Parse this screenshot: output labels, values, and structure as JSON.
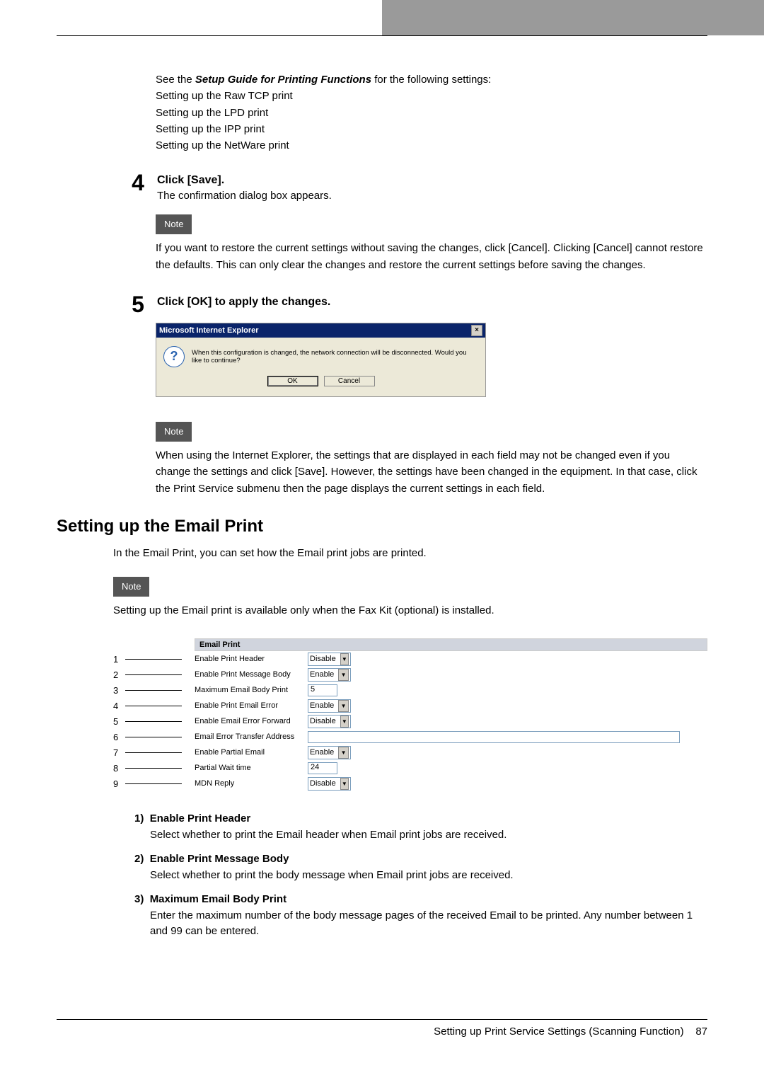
{
  "intro": {
    "prefix": "See the ",
    "guide_title": "Setup Guide for Printing Functions",
    "suffix": " for the following settings:",
    "lines": [
      "Setting up the Raw TCP print",
      "Setting up the LPD print",
      "Setting up the IPP print",
      "Setting up the NetWare print"
    ]
  },
  "step4": {
    "number": "4",
    "title": "Click [Save].",
    "desc": "The confirmation dialog box appears."
  },
  "note1": {
    "label": "Note",
    "text": "If you want to restore the current settings without saving the changes, click [Cancel]. Clicking [Cancel] cannot restore the defaults. This can only clear the changes and restore the current settings before saving the changes."
  },
  "step5": {
    "number": "5",
    "title": "Click [OK] to apply the changes."
  },
  "dialog": {
    "title": "Microsoft Internet Explorer",
    "message": "When this configuration is changed, the network connection will be disconnected.  Would you like to continue?",
    "ok": "OK",
    "cancel": "Cancel",
    "close": "×",
    "icon": "?"
  },
  "note2": {
    "label": "Note",
    "text": "When using the Internet Explorer, the settings that are displayed in each field may not be changed even if you change the settings and click [Save]. However, the settings have been changed in the equipment. In that case, click the Print Service submenu then the page displays the current settings in each field."
  },
  "section": {
    "heading": "Setting up the Email Print",
    "intro": "In the Email Print, you can set how the Email print jobs are printed."
  },
  "note3": {
    "label": "Note",
    "text": "Setting up the Email print is available only when the Fax Kit (optional) is installed."
  },
  "email_print": {
    "header": "Email Print",
    "rows": [
      {
        "num": "1",
        "label": "Enable Print Header",
        "type": "select",
        "value": "Disable"
      },
      {
        "num": "2",
        "label": "Enable Print Message Body",
        "type": "select",
        "value": "Enable"
      },
      {
        "num": "3",
        "label": "Maximum Email Body Print",
        "type": "input",
        "value": "5"
      },
      {
        "num": "4",
        "label": "Enable Print Email Error",
        "type": "select",
        "value": "Enable"
      },
      {
        "num": "5",
        "label": "Enable Email Error Forward",
        "type": "select",
        "value": "Disable"
      },
      {
        "num": "6",
        "label": "Email Error Transfer Address",
        "type": "input-long",
        "value": ""
      },
      {
        "num": "7",
        "label": "Enable Partial Email",
        "type": "select",
        "value": "Enable"
      },
      {
        "num": "8",
        "label": "Partial Wait time",
        "type": "input",
        "value": "24"
      },
      {
        "num": "9",
        "label": "MDN Reply",
        "type": "select",
        "value": "Disable"
      }
    ]
  },
  "definitions": [
    {
      "num": "1)",
      "title": "Enable Print Header",
      "body": "Select whether to print the Email header when Email print jobs are received."
    },
    {
      "num": "2)",
      "title": "Enable Print Message Body",
      "body": "Select whether to print the body message when Email print jobs are received."
    },
    {
      "num": "3)",
      "title": "Maximum Email Body Print",
      "body": "Enter the maximum number of the body message pages of the received Email to be printed. Any number between 1 and 99 can be entered."
    }
  ],
  "footer": {
    "title": "Setting up Print Service Settings (Scanning Function)",
    "page": "87"
  }
}
